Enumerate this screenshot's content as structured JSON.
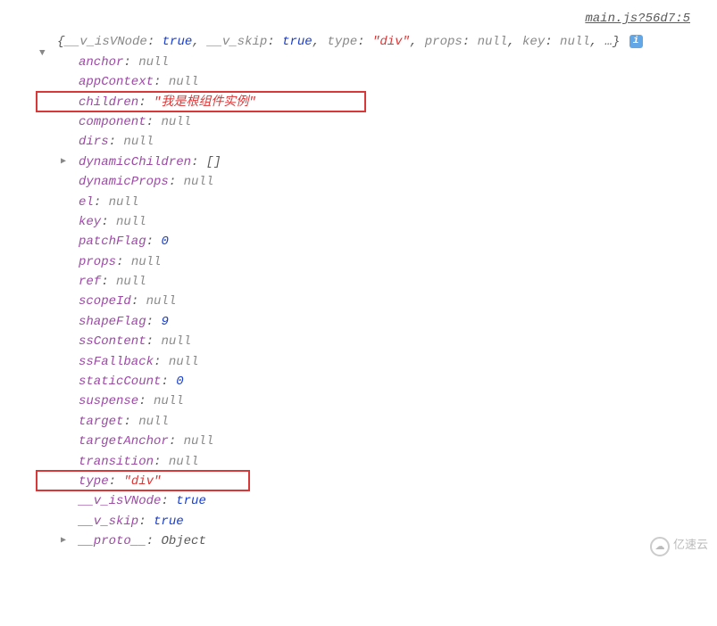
{
  "source": "main.js?56d7:5",
  "summary": {
    "prefix": "{",
    "parts": [
      {
        "key": "__v_isVNode",
        "value": "true",
        "vclass": "value-bool"
      },
      {
        "key": "__v_skip",
        "value": "true",
        "vclass": "value-bool"
      },
      {
        "key": "type",
        "value": "\"div\"",
        "vclass": "value-string"
      },
      {
        "key": "props",
        "value": "null",
        "vclass": "value-null"
      },
      {
        "key": "key",
        "value": "null",
        "vclass": "value-null"
      }
    ],
    "suffix": ", …}"
  },
  "info_badge": "i",
  "props": [
    {
      "key": "anchor",
      "value": "null",
      "vclass": "value-null"
    },
    {
      "key": "appContext",
      "value": "null",
      "vclass": "value-null"
    },
    {
      "key": "children",
      "value": "\"我是根组件实例\"",
      "vclass": "value-string",
      "highlighted": true
    },
    {
      "key": "component",
      "value": "null",
      "vclass": "value-null"
    },
    {
      "key": "dirs",
      "value": "null",
      "vclass": "value-null"
    },
    {
      "key": "dynamicChildren",
      "value": "[]",
      "vclass": "value-object",
      "expandable": true
    },
    {
      "key": "dynamicProps",
      "value": "null",
      "vclass": "value-null"
    },
    {
      "key": "el",
      "value": "null",
      "vclass": "value-null"
    },
    {
      "key": "key",
      "value": "null",
      "vclass": "value-null"
    },
    {
      "key": "patchFlag",
      "value": "0",
      "vclass": "value-number"
    },
    {
      "key": "props",
      "value": "null",
      "vclass": "value-null"
    },
    {
      "key": "ref",
      "value": "null",
      "vclass": "value-null"
    },
    {
      "key": "scopeId",
      "value": "null",
      "vclass": "value-null"
    },
    {
      "key": "shapeFlag",
      "value": "9",
      "vclass": "value-number"
    },
    {
      "key": "ssContent",
      "value": "null",
      "vclass": "value-null"
    },
    {
      "key": "ssFallback",
      "value": "null",
      "vclass": "value-null"
    },
    {
      "key": "staticCount",
      "value": "0",
      "vclass": "value-number"
    },
    {
      "key": "suspense",
      "value": "null",
      "vclass": "value-null"
    },
    {
      "key": "target",
      "value": "null",
      "vclass": "value-null"
    },
    {
      "key": "targetAnchor",
      "value": "null",
      "vclass": "value-null"
    },
    {
      "key": "transition",
      "value": "null",
      "vclass": "value-null"
    },
    {
      "key": "type",
      "value": "\"div\"",
      "vclass": "value-string",
      "highlighted": true
    },
    {
      "key": "__v_isVNode",
      "value": "true",
      "vclass": "value-bool"
    },
    {
      "key": "__v_skip",
      "value": "true",
      "vclass": "value-bool"
    },
    {
      "key": "__proto__",
      "value": "Object",
      "vclass": "value-object",
      "expandable": true
    }
  ],
  "watermark": "亿速云"
}
